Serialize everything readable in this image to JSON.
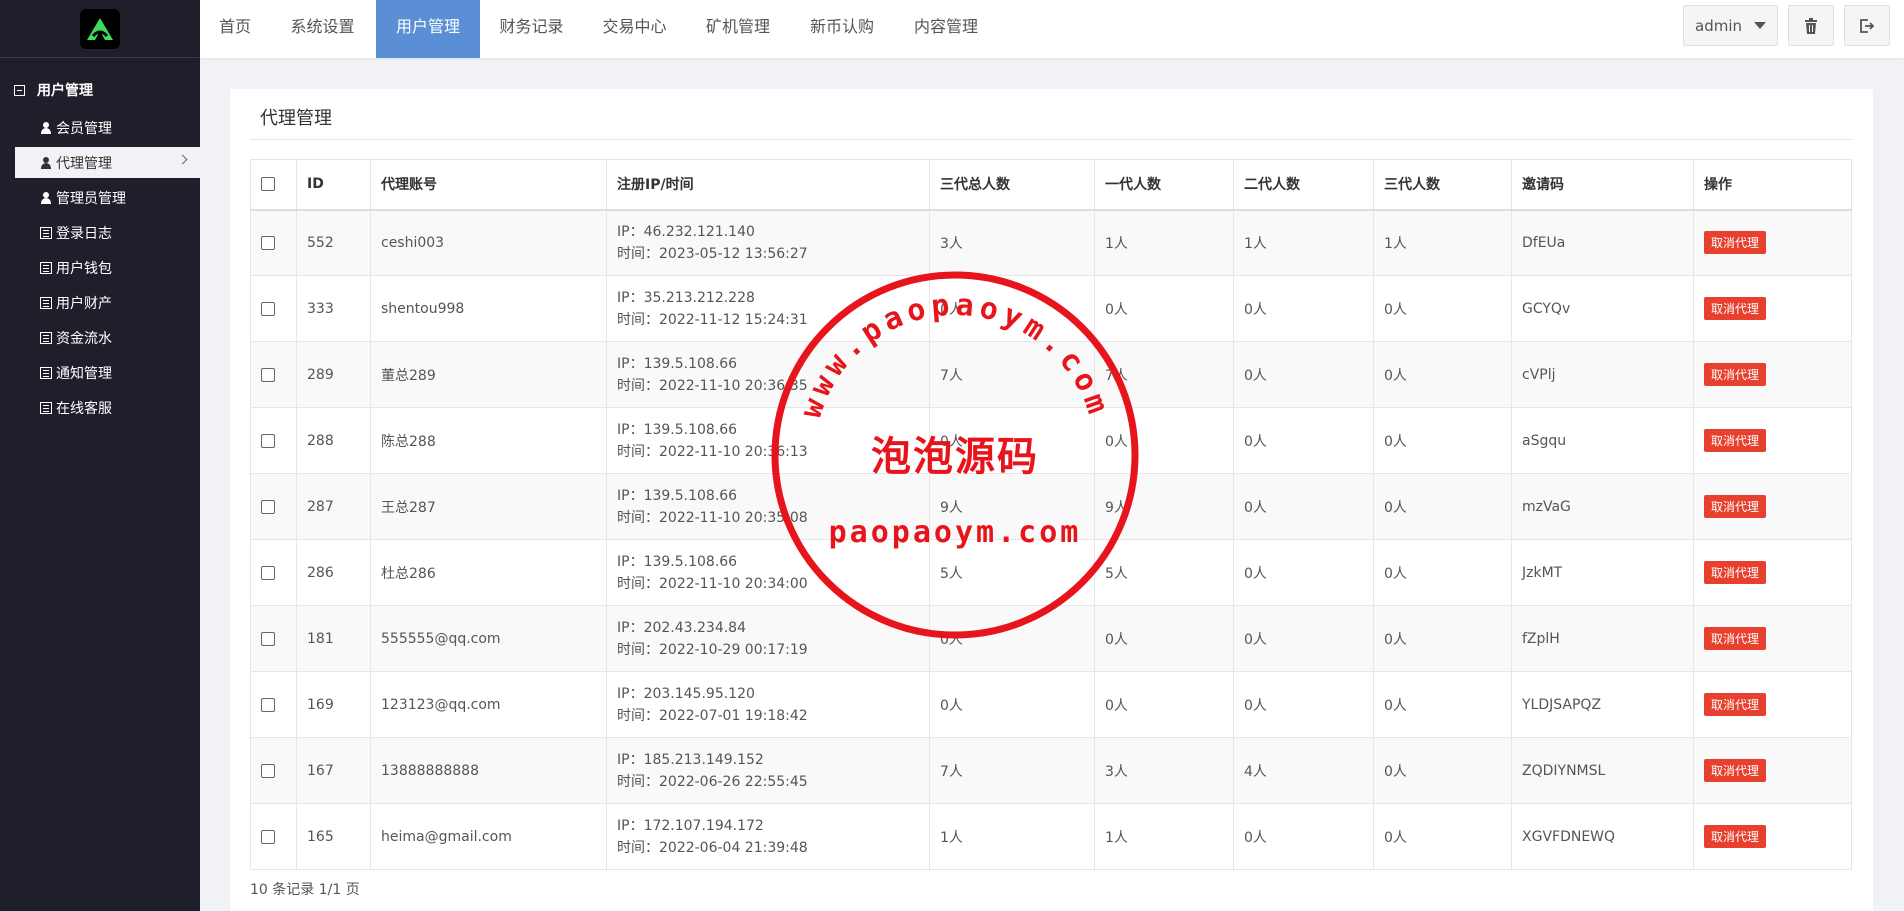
{
  "sidebar": {
    "group_title": "用户管理",
    "items": [
      {
        "label": "会员管理",
        "icon": "user-icon"
      },
      {
        "label": "代理管理",
        "icon": "user-icon",
        "active": true
      },
      {
        "label": "管理员管理",
        "icon": "user-icon"
      },
      {
        "label": "登录日志",
        "icon": "list-icon"
      },
      {
        "label": "用户钱包",
        "icon": "list-icon"
      },
      {
        "label": "用户财产",
        "icon": "list-icon"
      },
      {
        "label": "资金流水",
        "icon": "list-icon"
      },
      {
        "label": "通知管理",
        "icon": "list-icon"
      },
      {
        "label": "在线客服",
        "icon": "list-icon"
      }
    ]
  },
  "topnav": {
    "tabs": [
      "首页",
      "系统设置",
      "用户管理",
      "财务记录",
      "交易中心",
      "矿机管理",
      "新币认购",
      "内容管理"
    ],
    "active_tab": "用户管理",
    "user": "admin"
  },
  "page": {
    "title": "代理管理"
  },
  "table": {
    "headers": [
      "ID",
      "代理账号",
      "注册IP/时间",
      "三代总人数",
      "一代人数",
      "二代人数",
      "三代人数",
      "邀请码",
      "操作"
    ],
    "rows": [
      {
        "id": "552",
        "account": "ceshi003",
        "ip": "IP：46.232.121.140",
        "time": "时间：2023-05-12 13:56:27",
        "total": "3人",
        "g1": "1人",
        "g2": "1人",
        "g3": "1人",
        "code": "DfEUa",
        "action": "取消代理"
      },
      {
        "id": "333",
        "account": "shentou998",
        "ip": "IP：35.213.212.228",
        "time": "时间：2022-11-12 15:24:31",
        "total": "0人",
        "g1": "0人",
        "g2": "0人",
        "g3": "0人",
        "code": "GCYQv",
        "action": "取消代理"
      },
      {
        "id": "289",
        "account": "董总289",
        "ip": "IP：139.5.108.66",
        "time": "时间：2022-11-10 20:36:35",
        "total": "7人",
        "g1": "7人",
        "g2": "0人",
        "g3": "0人",
        "code": "cVPlj",
        "action": "取消代理"
      },
      {
        "id": "288",
        "account": "陈总288",
        "ip": "IP：139.5.108.66",
        "time": "时间：2022-11-10 20:36:13",
        "total": "0人",
        "g1": "0人",
        "g2": "0人",
        "g3": "0人",
        "code": "aSgqu",
        "action": "取消代理"
      },
      {
        "id": "287",
        "account": "王总287",
        "ip": "IP：139.5.108.66",
        "time": "时间：2022-11-10 20:35:08",
        "total": "9人",
        "g1": "9人",
        "g2": "0人",
        "g3": "0人",
        "code": "mzVaG",
        "action": "取消代理"
      },
      {
        "id": "286",
        "account": "杜总286",
        "ip": "IP：139.5.108.66",
        "time": "时间：2022-11-10 20:34:00",
        "total": "5人",
        "g1": "5人",
        "g2": "0人",
        "g3": "0人",
        "code": "JzkMT",
        "action": "取消代理"
      },
      {
        "id": "181",
        "account": "555555@qq.com",
        "ip": "IP：202.43.234.84",
        "time": "时间：2022-10-29 00:17:19",
        "total": "0人",
        "g1": "0人",
        "g2": "0人",
        "g3": "0人",
        "code": "fZplH",
        "action": "取消代理"
      },
      {
        "id": "169",
        "account": "123123@qq.com",
        "ip": "IP：203.145.95.120",
        "time": "时间：2022-07-01 19:18:42",
        "total": "0人",
        "g1": "0人",
        "g2": "0人",
        "g3": "0人",
        "code": "YLDJSAPQZ",
        "action": "取消代理"
      },
      {
        "id": "167",
        "account": "13888888888",
        "ip": "IP：185.213.149.152",
        "time": "时间：2022-06-26 22:55:45",
        "total": "7人",
        "g1": "3人",
        "g2": "4人",
        "g3": "0人",
        "code": "ZQDIYNMSL",
        "action": "取消代理"
      },
      {
        "id": "165",
        "account": "heima@gmail.com",
        "ip": "IP：172.107.194.172",
        "time": "时间：2022-06-04 21:39:48",
        "total": "1人",
        "g1": "1人",
        "g2": "0人",
        "g3": "0人",
        "code": "XGVFDNEWQ",
        "action": "取消代理"
      }
    ]
  },
  "pagination": {
    "summary": "10 条记录 1/1 页"
  },
  "watermark": {
    "arc_text": "www.paopaoym.com",
    "center_text": "泡泡源码",
    "bottom_text": "paopaoym.com"
  },
  "colors": {
    "sidebar_bg": "#1f1f2b",
    "active_tab": "#5a8fd6",
    "danger": "#e8402e",
    "logo_green": "#3ddc5a"
  }
}
